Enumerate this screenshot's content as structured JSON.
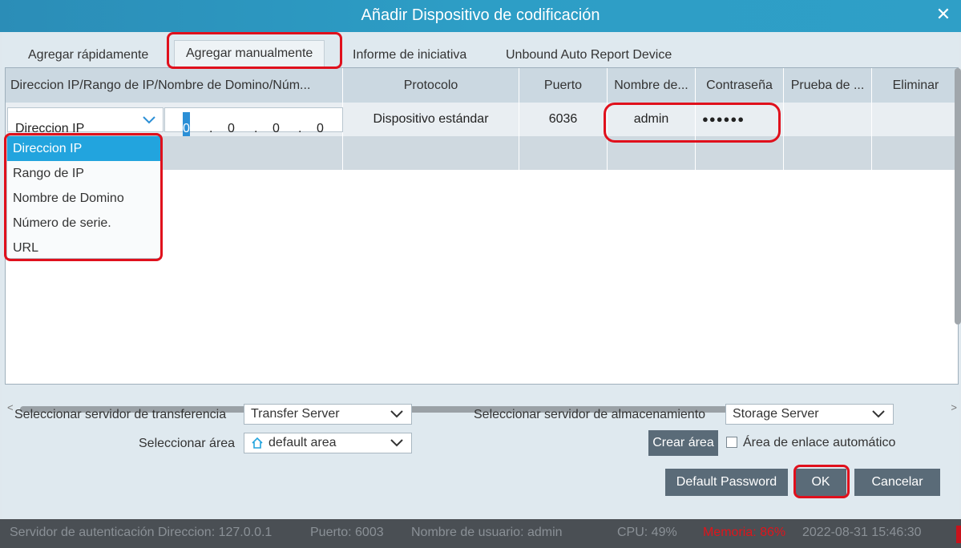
{
  "window": {
    "title": "Añadir Dispositivo de codificación",
    "close_glyph": "✕"
  },
  "tabs": [
    {
      "label": "Agregar rápidamente"
    },
    {
      "label": "Agregar manualmente"
    },
    {
      "label": "Informe de iniciativa"
    },
    {
      "label": "Unbound Auto Report Device"
    }
  ],
  "table": {
    "columns": [
      "Direccion IP/Rango de IP/Nombre de Domino/Núm...",
      "Protocolo",
      "Puerto",
      "Nombre de...",
      "Contraseña",
      "Prueba de ...",
      "Eliminar"
    ],
    "row": {
      "address_type": "Direccion IP",
      "ip": [
        "0",
        "0",
        "0",
        "0"
      ],
      "ip_sep": ".",
      "protocol": "Dispositivo estándar",
      "port": "6036",
      "username": "admin",
      "password": "●●●●●●"
    }
  },
  "dropdown": {
    "options": [
      "Direccion IP",
      "Rango de IP",
      "Nombre de Domino",
      "Número de serie.",
      "URL"
    ],
    "selected": "Direccion IP"
  },
  "form": {
    "transfer_label": "Seleccionar servidor de transferencia",
    "transfer_value": "Transfer Server",
    "storage_label": "Seleccionar servidor de almacenamiento",
    "storage_value": "Storage Server",
    "area_label": "Seleccionar área",
    "area_value": "default area",
    "create_area": "Crear área",
    "auto_link_label": "Área de enlace automático",
    "auto_link_checked": false
  },
  "buttons": {
    "default_password": "Default Password",
    "ok": "OK",
    "cancel": "Cancelar"
  },
  "status": {
    "auth_server": "Servidor de autenticación Direccion: 127.0.0.1",
    "port": "Puerto: 6003",
    "user": "Nombre de usuario: admin",
    "cpu": "CPU: 49%",
    "memory": "Memoria: 86%",
    "datetime": "2022-08-31 15:46:30"
  },
  "colors": {
    "accent": "#22a4de",
    "title_bar": "#2d9ec6",
    "highlight": "#e0101c",
    "button": "#5a6b78",
    "warning": "#e0141b"
  },
  "icons": {
    "close": "close-icon",
    "chevron": "chevron-down-icon",
    "home": "home-icon"
  }
}
